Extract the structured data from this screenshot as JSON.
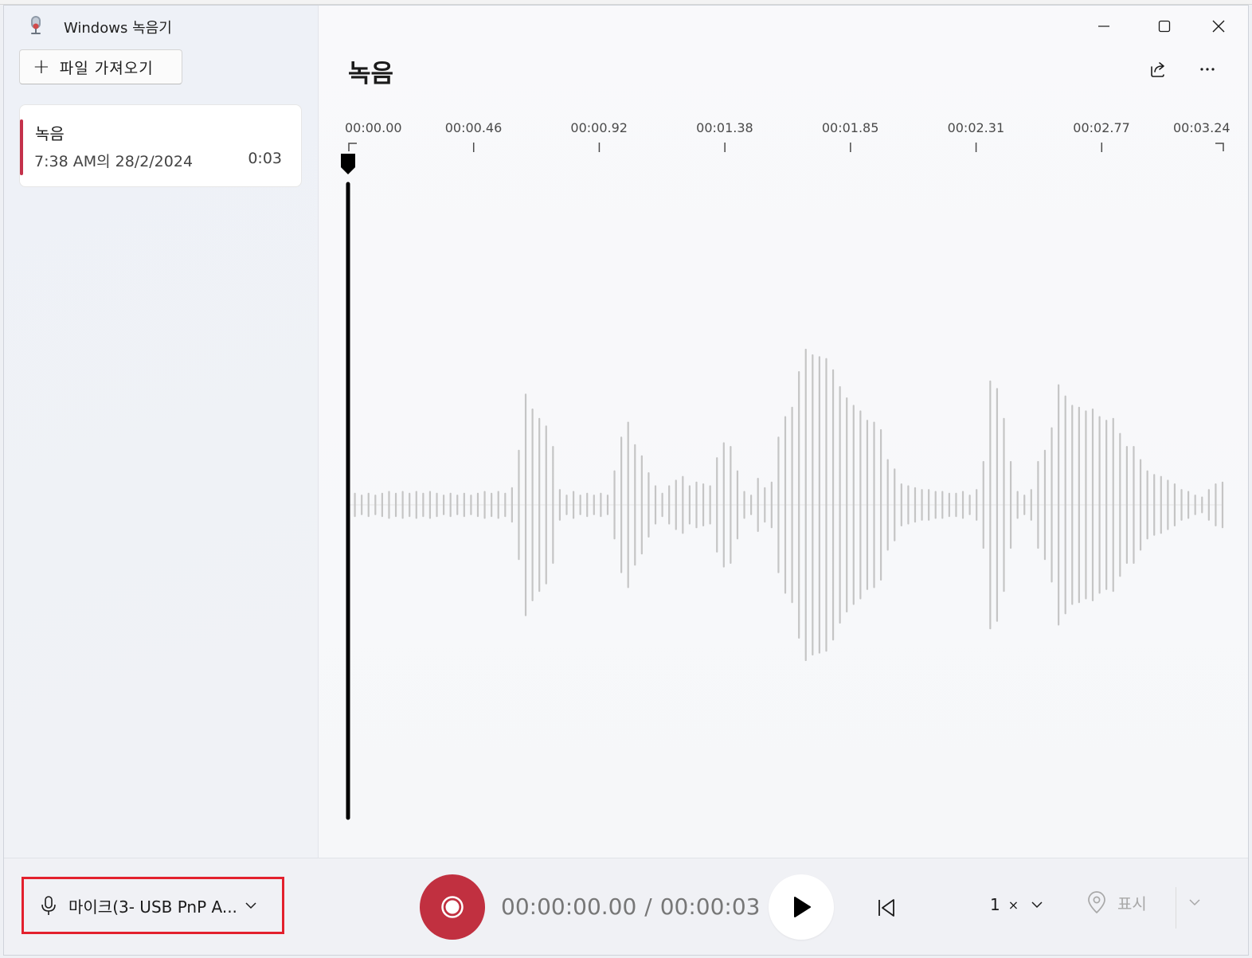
{
  "window": {
    "title": "Windows 녹음기",
    "controls": {
      "minimize": "minimize-icon",
      "maximize": "maximize-icon",
      "close": "close-icon"
    }
  },
  "sidebar": {
    "import_label": "파일 가져오기",
    "recordings": [
      {
        "name": "녹음",
        "date": "7:38 AM의 28/2/2024",
        "duration": "0:03",
        "selected": true
      }
    ]
  },
  "main": {
    "title": "녹음",
    "actions": [
      "share-icon",
      "more-icon"
    ],
    "ruler_labels": [
      "00:00.00",
      "00:00.46",
      "00:00.92",
      "00:01.38",
      "00:01.85",
      "00:02.31",
      "00:02.77",
      "00:03.24"
    ]
  },
  "waveform": {
    "duration_seconds": 3.24,
    "playhead_seconds": 0,
    "amplitudes": [
      0.05,
      0.06,
      0.05,
      0.06,
      0.05,
      0.06,
      0.07,
      0.06,
      0.07,
      0.06,
      0.07,
      0.06,
      0.07,
      0.06,
      0.05,
      0.06,
      0.05,
      0.06,
      0.05,
      0.06,
      0.07,
      0.06,
      0.07,
      0.06,
      0.09,
      0.29,
      0.59,
      0.51,
      0.46,
      0.42,
      0.31,
      0.08,
      0.05,
      0.07,
      0.05,
      0.06,
      0.05,
      0.06,
      0.05,
      0.18,
      0.36,
      0.44,
      0.32,
      0.26,
      0.17,
      0.1,
      0.06,
      0.1,
      0.13,
      0.15,
      0.1,
      0.12,
      0.11,
      0.1,
      0.25,
      0.33,
      0.31,
      0.18,
      0.07,
      0.05,
      0.14,
      0.09,
      0.12,
      0.36,
      0.47,
      0.52,
      0.71,
      0.83,
      0.8,
      0.79,
      0.78,
      0.72,
      0.63,
      0.57,
      0.53,
      0.5,
      0.45,
      0.44,
      0.4,
      0.24,
      0.19,
      0.11,
      0.1,
      0.09,
      0.08,
      0.08,
      0.07,
      0.07,
      0.06,
      0.06,
      0.07,
      0.05,
      0.08,
      0.23,
      0.66,
      0.62,
      0.46,
      0.23,
      0.07,
      0.05,
      0.08,
      0.23,
      0.29,
      0.41,
      0.64,
      0.58,
      0.53,
      0.52,
      0.5,
      0.51,
      0.47,
      0.45,
      0.46,
      0.38,
      0.31,
      0.31,
      0.24,
      0.18,
      0.16,
      0.15,
      0.13,
      0.11,
      0.08,
      0.07,
      0.05,
      0.04,
      0.08,
      0.11,
      0.12
    ]
  },
  "bottom": {
    "mic_label": "마이크(3- USB PnP A...",
    "current_time": "00:00:00.00",
    "separator": "/",
    "total_time": "00:00:03",
    "speed_value": "1",
    "speed_unit": "×",
    "mark_label": "표시"
  },
  "colors": {
    "accent_red": "#c13040",
    "selection_bar": "#c4314b",
    "highlight_box": "#e3202d",
    "wave_bar": "#c5c5c5",
    "playhead": "#000000"
  }
}
